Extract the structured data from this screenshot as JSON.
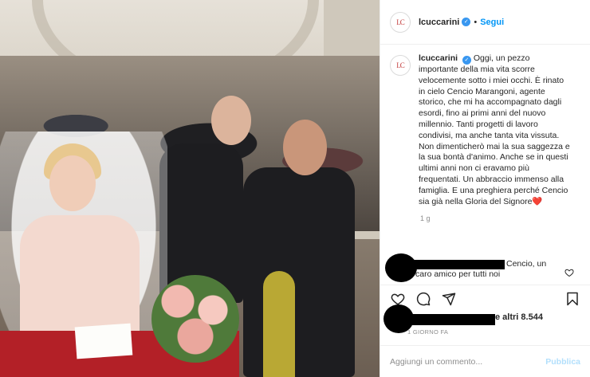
{
  "post": {
    "username": "lcuccarini",
    "avatar_text": "LC",
    "follow_label": "Segui",
    "separator": "•",
    "verified_icon": "verified-badge-icon",
    "caption": "Oggi, un pezzo importante della mia vita scorre velocemente sotto i miei occhi. È rinato in cielo Cencio Marangoni, agente storico, che mi ha accompagnato dagli esordi, fino ai primi anni del nuovo millennio. Tanti progetti di lavoro condivisi, ma anche tanta vita vissuta. Non dimenticherò mai la sua saggezza e la sua bontà d'animo. Anche se in questi ultimi anni non ci eravamo più frequentati. Un abbraccio immenso alla famiglia. E una preghiera perché Cencio sia già nella Gloria del Signore",
    "caption_emoji": "❤️",
    "time_ago": "1 g"
  },
  "comment": {
    "text_line1": "Cencio, un",
    "text_line2": "caro amico per tutti noi"
  },
  "likes": {
    "text": "e altri 8.544",
    "date": "1 GIORNO FA"
  },
  "add_comment": {
    "placeholder": "Aggiungi un commento...",
    "publish_label": "Pubblica"
  },
  "colors": {
    "accent": "#0095f6",
    "publish_disabled": "#b2dffc",
    "verified": "#3897f0",
    "like_heart": "#ed4956"
  }
}
